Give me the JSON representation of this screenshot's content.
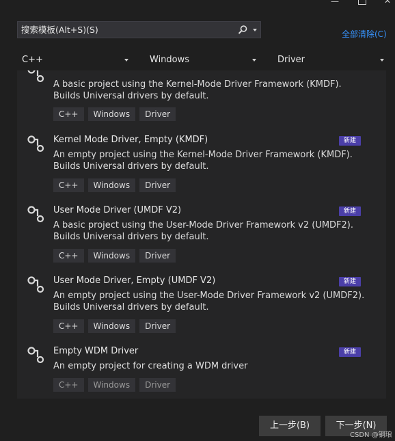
{
  "window": {
    "minimize_glyph": "—",
    "close_glyph": "✕"
  },
  "search": {
    "placeholder": "搜索模板(Alt+S)(S)",
    "value": ""
  },
  "clear_all": "全部清除(C)",
  "filters": [
    {
      "label": "C++"
    },
    {
      "label": "Windows"
    },
    {
      "label": "Driver"
    }
  ],
  "templates": [
    {
      "title": "",
      "desc_line1": "A basic project using the Kernel-Mode Driver Framework (KMDF).",
      "desc_line2": "Builds Universal drivers by default.",
      "tags": [
        "C++",
        "Windows",
        "Driver"
      ],
      "badge": "",
      "icon": "project-template-icon"
    },
    {
      "title": "Kernel Mode Driver, Empty (KMDF)",
      "desc_line1": "An empty project using the Kernel-Mode Driver Framework (KMDF).",
      "desc_line2": "Builds Universal drivers by default.",
      "tags": [
        "C++",
        "Windows",
        "Driver"
      ],
      "badge": "新建",
      "icon": "project-template-icon"
    },
    {
      "title": "User Mode Driver (UMDF V2)",
      "desc_line1": "A basic project using the User-Mode Driver Framework v2 (UMDF2).",
      "desc_line2": "Builds Universal drivers by default.",
      "tags": [
        "C++",
        "Windows",
        "Driver"
      ],
      "badge": "新建",
      "icon": "project-template-icon"
    },
    {
      "title": "User Mode Driver, Empty (UMDF V2)",
      "desc_line1": "An empty project using the User-Mode Driver Framework v2 (UMDF2).",
      "desc_line2": "Builds Universal drivers by default.",
      "tags": [
        "C++",
        "Windows",
        "Driver"
      ],
      "badge": "新建",
      "icon": "project-template-icon"
    },
    {
      "title": "Empty WDM Driver",
      "desc_line1": "An empty project for creating a WDM driver",
      "desc_line2": "",
      "tags": [
        "C++",
        "Windows",
        "Driver"
      ],
      "badge": "新建",
      "icon": "project-template-icon"
    }
  ],
  "footer": {
    "back_label": "上一步(B)",
    "next_label": "下一步(N)"
  },
  "watermark": "CSDN @钢琅",
  "colors": {
    "link": "#3794ff",
    "badge": "#4b3fa8",
    "background": "#1f1f1f",
    "list_bg": "#252526"
  }
}
